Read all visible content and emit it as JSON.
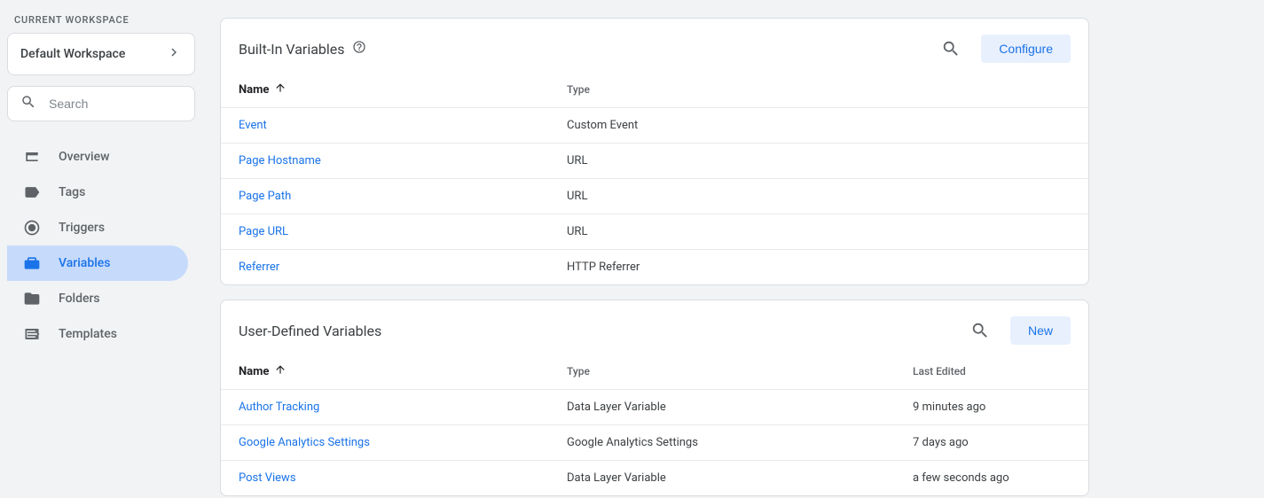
{
  "workspace": {
    "label": "CURRENT WORKSPACE",
    "name": "Default Workspace",
    "search_placeholder": "Search"
  },
  "nav": {
    "overview": "Overview",
    "tags": "Tags",
    "triggers": "Triggers",
    "variables": "Variables",
    "folders": "Folders",
    "templates": "Templates"
  },
  "builtin": {
    "title": "Built-In Variables",
    "configure": "Configure",
    "cols": {
      "name": "Name",
      "type": "Type"
    },
    "rows": [
      {
        "name": "Event",
        "type": "Custom Event"
      },
      {
        "name": "Page Hostname",
        "type": "URL"
      },
      {
        "name": "Page Path",
        "type": "URL"
      },
      {
        "name": "Page URL",
        "type": "URL"
      },
      {
        "name": "Referrer",
        "type": "HTTP Referrer"
      }
    ]
  },
  "userdef": {
    "title": "User-Defined Variables",
    "new": "New",
    "cols": {
      "name": "Name",
      "type": "Type",
      "last_edited": "Last Edited"
    },
    "rows": [
      {
        "name": "Author Tracking",
        "type": "Data Layer Variable",
        "last_edited": "9 minutes ago"
      },
      {
        "name": "Google Analytics Settings",
        "type": "Google Analytics Settings",
        "last_edited": "7 days ago"
      },
      {
        "name": "Post Views",
        "type": "Data Layer Variable",
        "last_edited": "a few seconds ago"
      }
    ]
  }
}
